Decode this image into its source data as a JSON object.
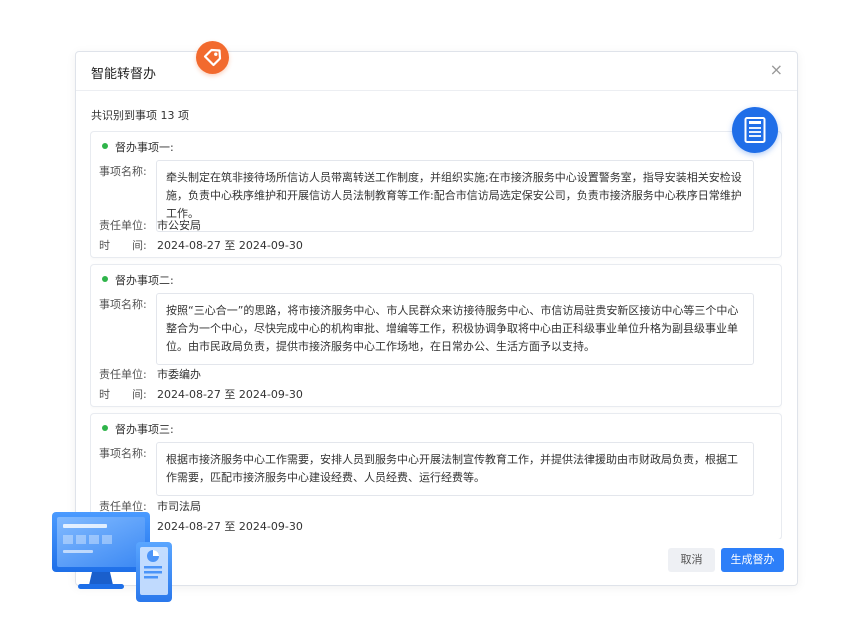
{
  "dialog": {
    "title": "智能转督办",
    "close_glyph": "×",
    "summary": "共识别到事项 13 项"
  },
  "labels": {
    "name": "事项名称:",
    "unit": "责任单位:",
    "time": "时　　间:"
  },
  "items": [
    {
      "title": "督办事项一:",
      "content": "牵头制定在筑非接待场所信访人员带离转送工作制度，并组织实施;在市接济服务中心设置警务室，指导安装相关安检设施，负责中心秩序维护和开展信访人员法制教育等工作:配合市信访局选定保安公司，负责市接济服务中心秩序日常维护工作。",
      "unit": "市公安局",
      "time": "2024-08-27 至 2024-09-30"
    },
    {
      "title": "督办事项二:",
      "content": "按照“三心合一”的思路，将市接济服务中心、市人民群众来访接待服务中心、市信访局驻贵安新区接访中心等三个中心整合为一个中心，尽快完成中心的机构审批、增编等工作，积极协调争取将中心由正科级事业单位升格为副县级事业单位。由市民政局负责，提供市接济服务中心工作场地，在日常办公、生活方面予以支持。",
      "unit": "市委编办",
      "time": "2024-08-27 至 2024-09-30"
    },
    {
      "title": "督办事项三:",
      "content": "根据市接济服务中心工作需要，安排人员到服务中心开展法制宣传教育工作，并提供法律援助由市财政局负责，根据工作需要，匹配市接济服务中心建设经费、人员经费、运行经费等。",
      "unit": "市司法局",
      "time": "2024-08-27 至 2024-09-30"
    }
  ],
  "footer": {
    "cancel_label": "取消",
    "generate_label": "生成督办"
  },
  "icons": {
    "tag": "tag-icon",
    "document": "document-icon",
    "devices": "devices-illustration",
    "status_dot": "status-dot-icon"
  },
  "colors": {
    "primary": "#2d7ff9",
    "success": "#2fb44a",
    "tag": "#f26a2e",
    "doc_badge": "#1f6ee8"
  }
}
